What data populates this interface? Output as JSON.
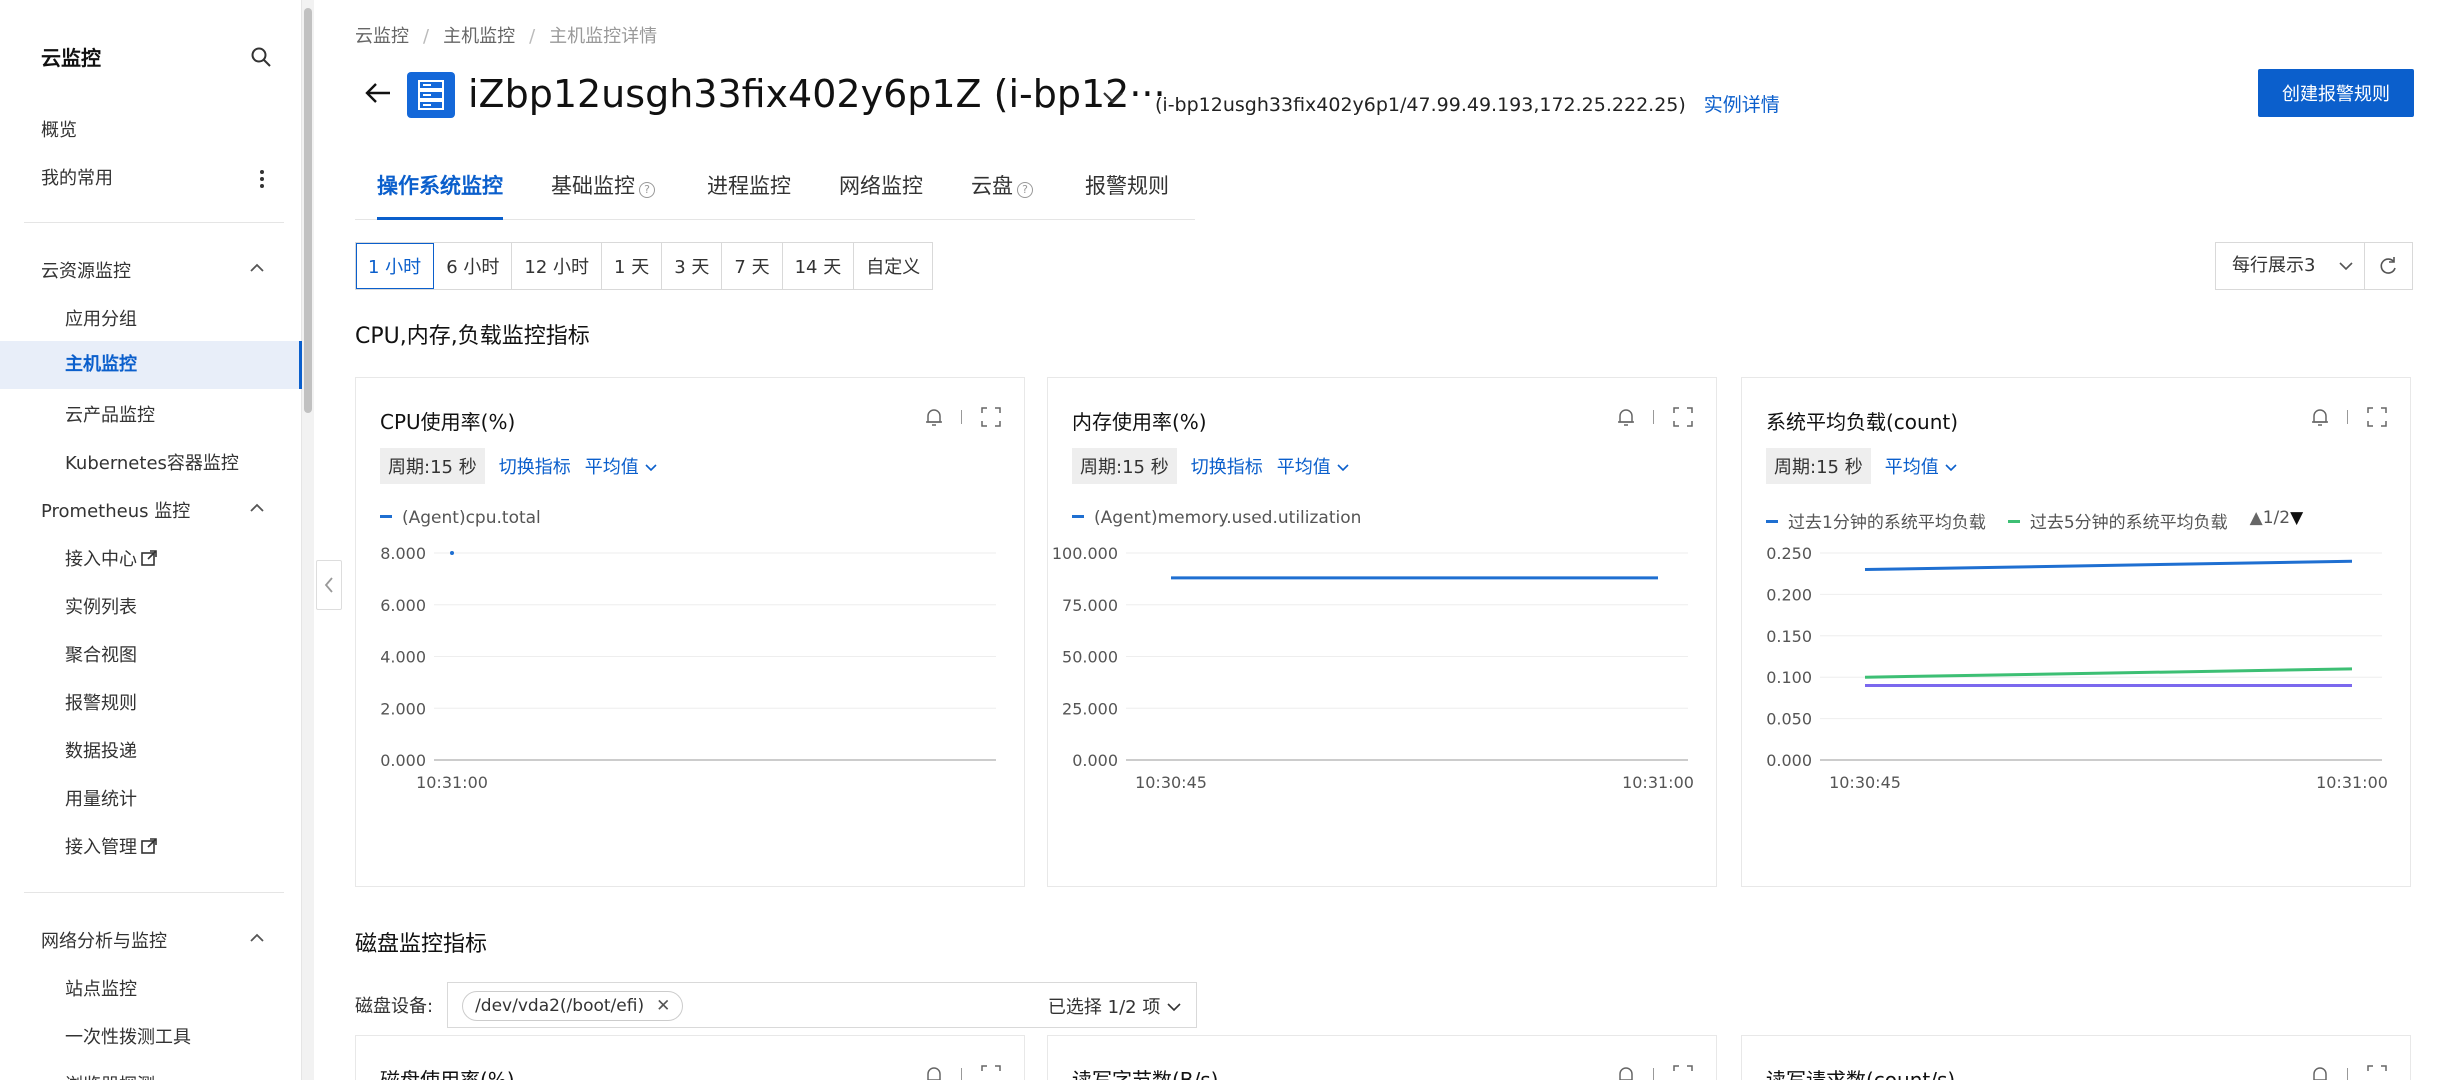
{
  "sidebar": {
    "title": "云监控",
    "items": [
      {
        "label": "概览"
      },
      {
        "label": "我的常用"
      }
    ],
    "groups": [
      {
        "label": "云资源监控",
        "children": [
          "应用分组",
          "主机监控",
          "云产品监控",
          "Kubernetes容器监控"
        ]
      },
      {
        "label": "Prometheus 监控",
        "children": [
          "接入中心",
          "实例列表",
          "聚合视图",
          "报警规则",
          "数据投递",
          "用量统计",
          "接入管理"
        ]
      },
      {
        "label": "网络分析与监控",
        "children": [
          "站点监控",
          "一次性拨测工具",
          "浏览器探测"
        ]
      }
    ],
    "active": "主机监控"
  },
  "breadcrumb": [
    "云监控",
    "主机监控",
    "主机监控详情"
  ],
  "header": {
    "title": "iZbp12usgh33fix402y6p1Z (i-bp12···",
    "meta": "(i-bp12usgh33fix402y6p1/47.99.49.193,172.25.222.25)",
    "detail_link": "实例详情",
    "create_button": "创建报警规则"
  },
  "tabs": [
    "操作系统监控",
    "基础监控",
    "进程监控",
    "网络监控",
    "云盘",
    "报警规则"
  ],
  "time_ranges": [
    "1 小时",
    "6 小时",
    "12 小时",
    "1 天",
    "3 天",
    "7 天",
    "14 天",
    "自定义"
  ],
  "active_range": "1 小时",
  "per_row": "每行展示3",
  "section1_title": "CPU,内存,负载监控指标",
  "section2_title": "磁盘监控指标",
  "disk": {
    "label": "磁盘设备:",
    "tag": "/dev/vda2(/boot/efi)",
    "count": "已选择 1/2 项"
  },
  "cards": [
    {
      "title": "CPU使用率(%)",
      "period": "周期:15 秒",
      "switch": "切换指标",
      "agg": "平均值",
      "chart_data": {
        "type": "line",
        "series": [
          {
            "name": "(Agent)cpu.total",
            "color": "#1f6fd1",
            "values": [
              8.0
            ]
          }
        ],
        "x": [
          "10:31:00"
        ],
        "yticks": [
          "8.000",
          "6.000",
          "4.000",
          "2.000",
          "0.000"
        ],
        "ylim": [
          0,
          8
        ],
        "xticks": [
          "10:31:00"
        ]
      }
    },
    {
      "title": "内存使用率(%)",
      "period": "周期:15 秒",
      "switch": "切换指标",
      "agg": "平均值",
      "chart_data": {
        "type": "line",
        "series": [
          {
            "name": "(Agent)memory.used.utilization",
            "color": "#1f6fd1",
            "values": [
              88,
              88
            ]
          }
        ],
        "x": [
          "10:30:45",
          "10:31:00"
        ],
        "yticks": [
          "100.000",
          "75.000",
          "50.000",
          "25.000",
          "0.000"
        ],
        "ylim": [
          0,
          100
        ],
        "xticks": [
          "10:30:45",
          "10:31:00"
        ]
      }
    },
    {
      "title": "系统平均负载(count)",
      "period": "周期:15 秒",
      "agg": "平均值",
      "legend_page": "1/2",
      "chart_data": {
        "type": "line",
        "series": [
          {
            "name": "过去1分钟的系统平均负载",
            "color": "#1f6fd1",
            "values": [
              0.23,
              0.24
            ]
          },
          {
            "name": "过去5分钟的系统平均负载",
            "color": "#3dbf74",
            "values": [
              0.1,
              0.11
            ]
          },
          {
            "name": "",
            "color": "#7b68ee",
            "values": [
              0.09,
              0.09
            ]
          }
        ],
        "x": [
          "10:30:45",
          "10:31:00"
        ],
        "yticks": [
          "0.250",
          "0.200",
          "0.150",
          "0.100",
          "0.050",
          "0.000"
        ],
        "ylim": [
          0,
          0.25
        ],
        "xticks": [
          "10:30:45",
          "10:31:00"
        ]
      }
    }
  ],
  "cards2": [
    "磁盘使用率(%)",
    "读写字节数(B/s)",
    "读写请求数(count/s)"
  ]
}
